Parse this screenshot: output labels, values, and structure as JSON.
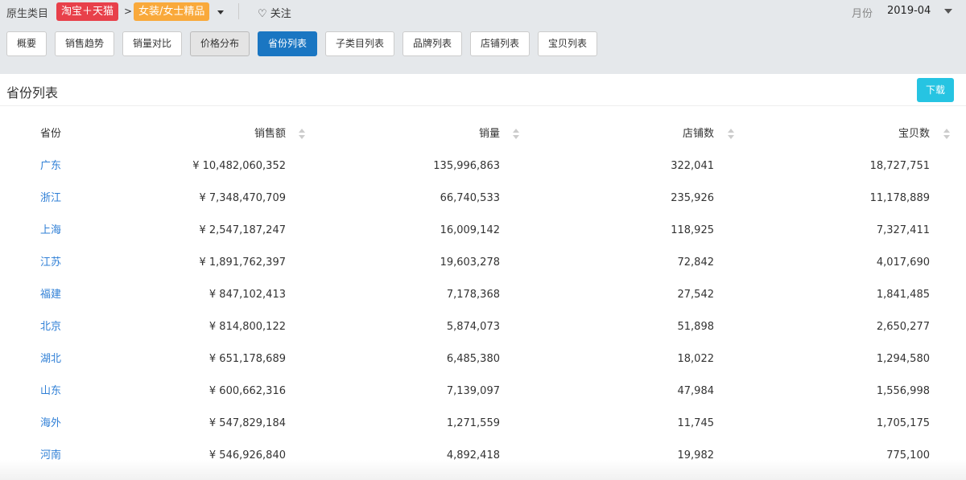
{
  "header": {
    "category_label": "原生类目",
    "platform": "淘宝＋天猫",
    "separator": ">",
    "category": "女装/女士精品",
    "follow": "♡ 关注",
    "month_label": "月份",
    "month_value": "2019-04"
  },
  "tabs": [
    "概要",
    "销售趋势",
    "销量对比",
    "价格分布",
    "省份列表",
    "子类目列表",
    "品牌列表",
    "店铺列表",
    "宝贝列表"
  ],
  "active_tab": "省份列表",
  "panel": {
    "title": "省份列表",
    "download": "下载"
  },
  "table": {
    "columns": [
      "省份",
      "销售额",
      "销量",
      "店铺数",
      "宝贝数"
    ],
    "rows": [
      [
        "广东",
        "¥  10,482,060,352",
        "135,996,863",
        "322,041",
        "18,727,751"
      ],
      [
        "浙江",
        "¥  7,348,470,709",
        "66,740,533",
        "235,926",
        "11,178,889"
      ],
      [
        "上海",
        "¥  2,547,187,247",
        "16,009,142",
        "118,925",
        "7,327,411"
      ],
      [
        "江苏",
        "¥  1,891,762,397",
        "19,603,278",
        "72,842",
        "4,017,690"
      ],
      [
        "福建",
        "¥  847,102,413",
        "7,178,368",
        "27,542",
        "1,841,485"
      ],
      [
        "北京",
        "¥  814,800,122",
        "5,874,073",
        "51,898",
        "2,650,277"
      ],
      [
        "湖北",
        "¥  651,178,689",
        "6,485,380",
        "18,022",
        "1,294,580"
      ],
      [
        "山东",
        "¥  600,662,316",
        "7,139,097",
        "47,984",
        "1,556,998"
      ],
      [
        "海外",
        "¥  547,829,184",
        "1,271,559",
        "11,745",
        "1,705,175"
      ],
      [
        "河南",
        "¥  546,926,840",
        "4,892,418",
        "19,982",
        "775,100"
      ]
    ]
  }
}
